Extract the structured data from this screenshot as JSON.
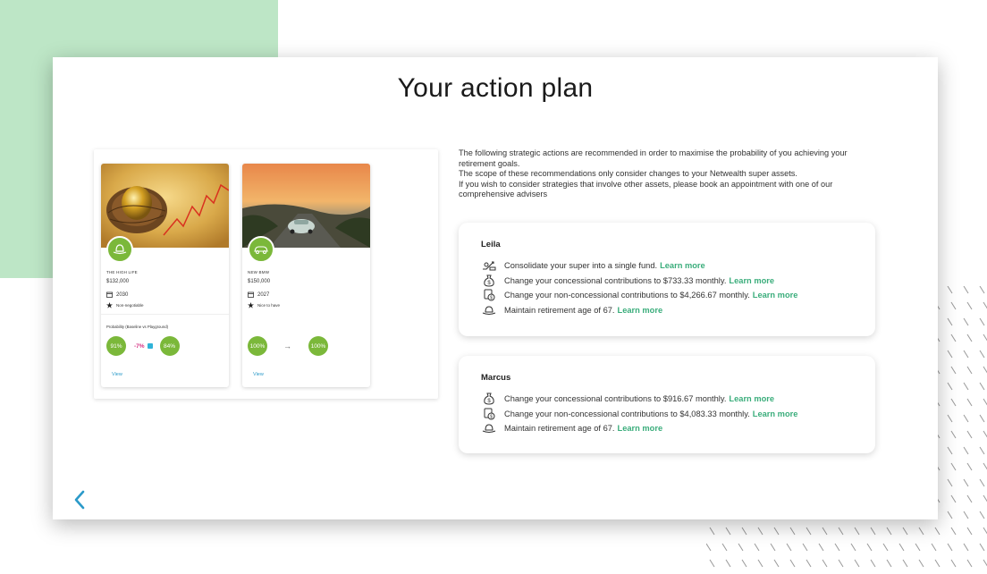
{
  "page": {
    "title": "Your action plan"
  },
  "goals": [
    {
      "name": "THE HIGH LIFE",
      "amount": "$132,000",
      "year": "2030",
      "tag": "Non-negotiable",
      "probability_label": "Probability (Baseline vs Playground)",
      "baseline": "91%",
      "change": "-7%",
      "playground": "84%",
      "view_label": "View",
      "icon": "hat-icon"
    },
    {
      "name": "NEW BMW",
      "amount": "$150,000",
      "year": "2027",
      "tag": "Nice to have",
      "baseline": "100%",
      "arrow": "→",
      "playground": "100%",
      "view_label": "View",
      "icon": "car-icon"
    }
  ],
  "intro": {
    "line1": "The following strategic actions are recommended in order to maximise the probability of you achieving your retirement goals.",
    "line2": "The scope of these recommendations only consider changes to your Netwealth super assets.",
    "line3": "If you wish to consider strategies that involve other assets, please book an appointment with one of our comprehensive advisers"
  },
  "people": [
    {
      "name": "Leila",
      "actions": [
        {
          "text": "Consolidate your super into a single fund.",
          "link": "Learn more",
          "icon": "consolidate-icon"
        },
        {
          "text": "Change your concessional contributions to $733.33 monthly.",
          "link": "Learn more",
          "icon": "money-bag-icon"
        },
        {
          "text": "Change your non-concessional contributions to $4,266.67 monthly.",
          "link": "Learn more",
          "icon": "money-stack-icon"
        },
        {
          "text": "Maintain retirement age of 67.",
          "link": "Learn more",
          "icon": "hat-icon"
        }
      ]
    },
    {
      "name": "Marcus",
      "actions": [
        {
          "text": "Change your concessional contributions to $916.67 monthly.",
          "link": "Learn more",
          "icon": "money-bag-icon"
        },
        {
          "text": "Change your non-concessional contributions to $4,083.33 monthly.",
          "link": "Learn more",
          "icon": "money-stack-icon"
        },
        {
          "text": "Maintain retirement age of 67.",
          "link": "Learn more",
          "icon": "hat-icon"
        }
      ]
    }
  ],
  "colors": {
    "accent_green": "#7bb83a",
    "link_green": "#3aad7b",
    "link_blue": "#2b9ac9",
    "background_green": "#bde6c6",
    "negative_pink": "#d63384"
  }
}
